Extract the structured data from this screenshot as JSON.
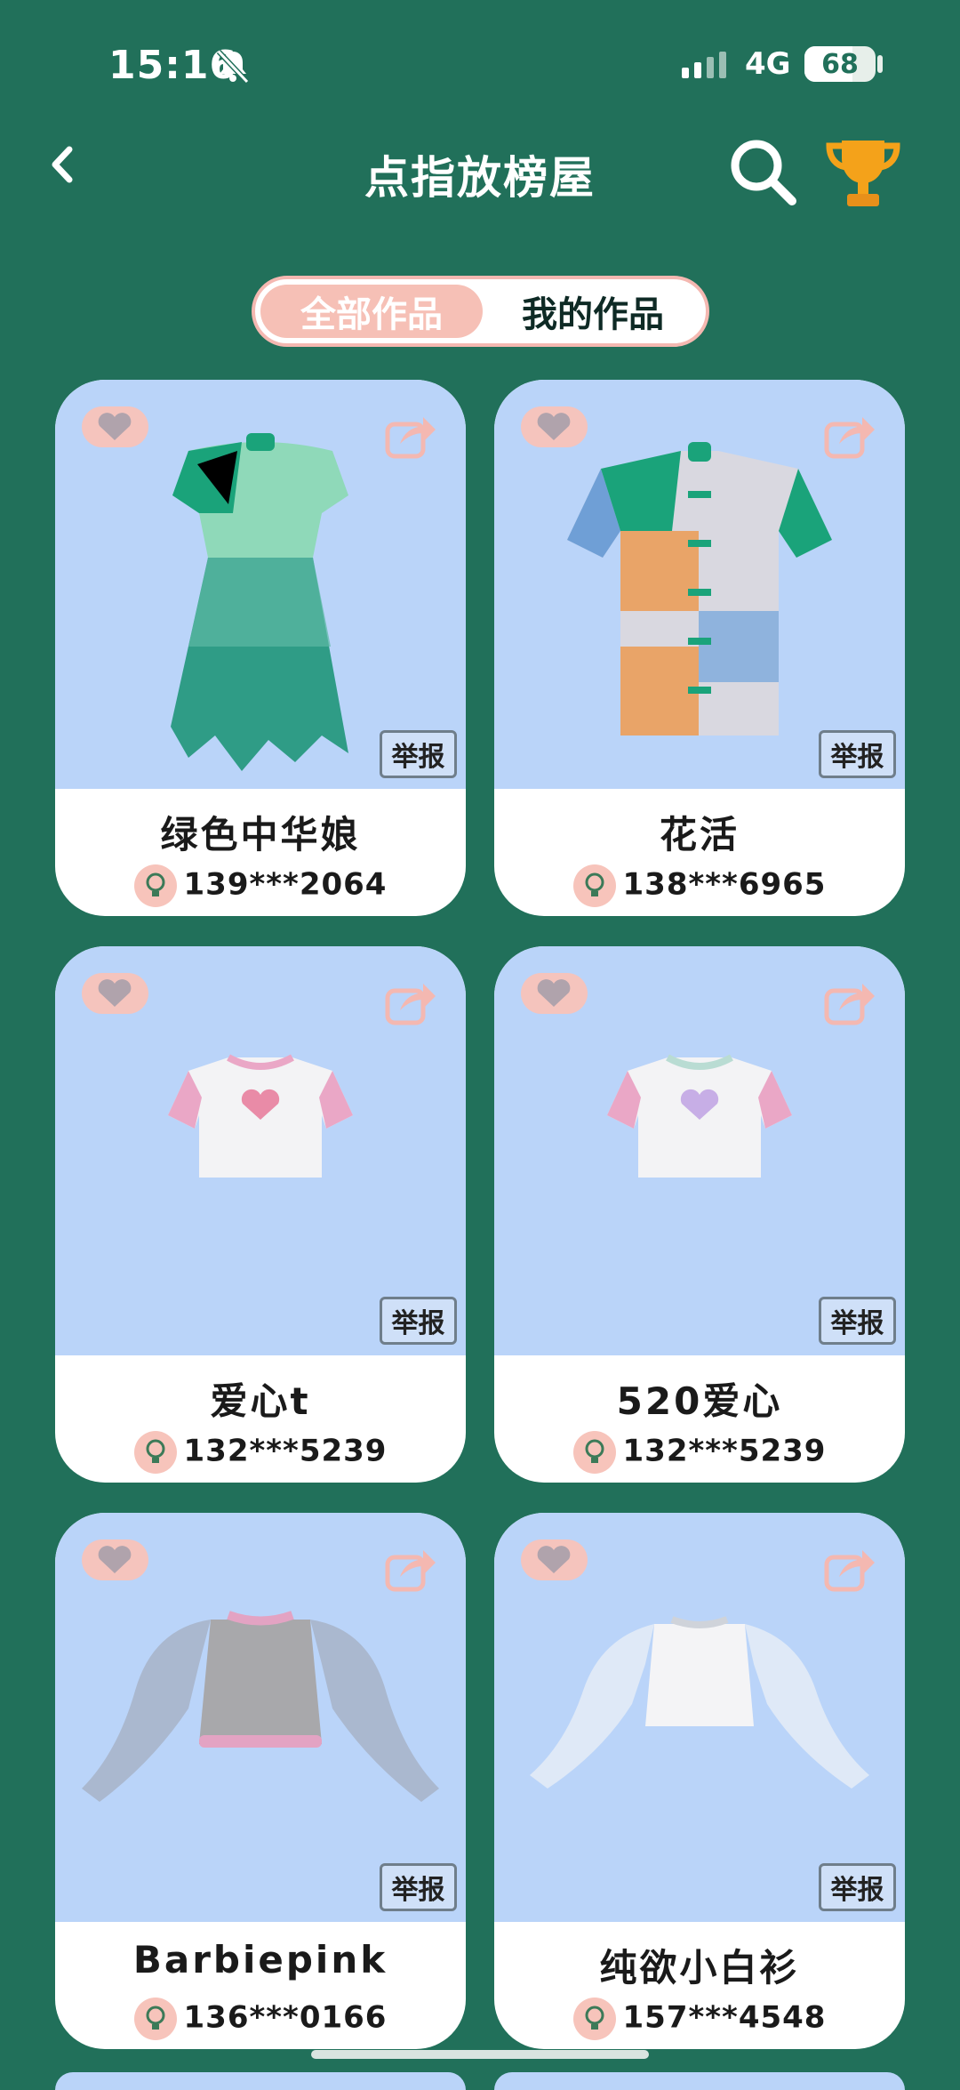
{
  "status_bar": {
    "time": "15:16",
    "network": "4G",
    "battery": "68",
    "battery_level": 0.68
  },
  "header": {
    "title": "点指放榜屋",
    "back_icon": "chevron-left-icon",
    "search_icon": "search-icon",
    "trophy_icon": "trophy-icon"
  },
  "tabs": [
    {
      "label": "全部作品",
      "active": true
    },
    {
      "label": "我的作品",
      "active": false
    }
  ],
  "cards": [
    {
      "name": "绿色中华娘",
      "user": "139***2064",
      "report": "举报",
      "garment": "green-qipao-dress"
    },
    {
      "name": "花活",
      "user": "138***6965",
      "report": "举报",
      "garment": "tie-dye-shirt"
    },
    {
      "name": "爱心t",
      "user": "132***5239",
      "report": "举报",
      "garment": "heart-tee-pink"
    },
    {
      "name": "520爱心",
      "user": "132***5239",
      "report": "举报",
      "garment": "heart-tee-purple"
    },
    {
      "name": "Barbiepink",
      "user": "136***0166",
      "report": "举报",
      "garment": "grey-puff-sleeve-top"
    },
    {
      "name": "纯欲小白衫",
      "user": "157***4548",
      "report": "举报",
      "garment": "white-puff-sleeve-top"
    }
  ],
  "colors": {
    "background": "#21705a",
    "card_image_bg": "#bad4f9",
    "accent_pink": "#f6c0b6"
  }
}
